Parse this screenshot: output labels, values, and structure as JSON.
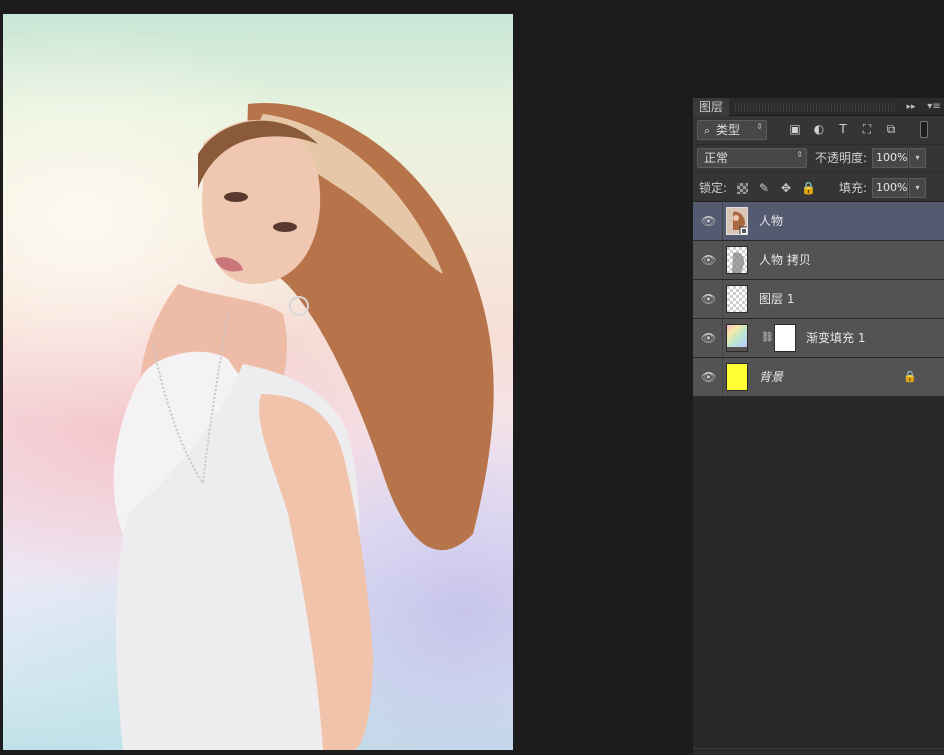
{
  "window": {
    "document_background_color": "#1c1c1c"
  },
  "layers_panel": {
    "tab_label": "图层",
    "collapse_glyph": "▸▸",
    "menu_glyph": "▾≡",
    "filter": {
      "kind_label": "类型",
      "kind_glyph": "⌕",
      "selector_arrows": "⇕",
      "icons": [
        "image-filter-icon",
        "adjustment-filter-icon",
        "type-filter-icon",
        "shape-filter-icon",
        "smart-object-filter-icon"
      ],
      "icon_glyphs": [
        "▣",
        "◐",
        "T",
        "⛶",
        "⧉"
      ]
    },
    "blend": {
      "mode": "正常",
      "opacity_label": "不透明度:",
      "opacity_value": "100%"
    },
    "lock": {
      "label": "锁定:",
      "paint_glyph": "✎",
      "move_glyph": "✥",
      "lock_glyph": "🔒",
      "fill_label": "填充:",
      "fill_value": "100%"
    },
    "dropdown_glyph": "▾",
    "eye_glyph": "👁",
    "layers": [
      {
        "name": "人物",
        "selected": true,
        "type": "smart-object",
        "thumb_color": "#b88060"
      },
      {
        "name": "人物 拷贝",
        "selected": false,
        "type": "pixel",
        "thumb_color": "#9a9a9a"
      },
      {
        "name": "图层 1",
        "selected": false,
        "type": "pixel-empty",
        "thumb_color": "#ffffff"
      },
      {
        "name": "渐变填充 1",
        "selected": false,
        "type": "gradient-fill",
        "thumb_color": "#c6b8f0"
      },
      {
        "name": "背景",
        "selected": false,
        "type": "background",
        "thumb_color": "#ffff33",
        "locked": true
      }
    ],
    "chain_glyph": "⛓",
    "bg_lock_glyph": "🔒"
  }
}
